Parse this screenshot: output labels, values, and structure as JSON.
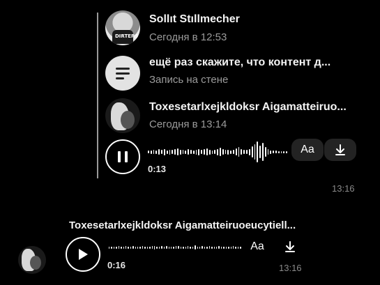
{
  "forwarded": {
    "items": [
      {
        "name": "Sollıt Stıllmecher",
        "time": "Сегодня в 12:53",
        "avatar_text": "DIRTERS"
      },
      {
        "title": "ещё раз скажите, что контент д...",
        "subtitle": "Запись на стене"
      },
      {
        "name": "Toxesetarlxejkldoksr Aigamatteiruo...",
        "time": "Сегодня в 13:14"
      }
    ],
    "voice": {
      "duration": "0:13",
      "state": "playing",
      "transcribe_label": "Aa"
    },
    "timestamp": "13:16"
  },
  "message": {
    "sender": "Toxesetarlxejkldoksr Aigamatteiruoeucytiell...",
    "voice": {
      "duration": "0:16",
      "state": "paused",
      "transcribe_label": "Aa"
    },
    "timestamp": "13:16"
  },
  "colors": {
    "background": "#000000",
    "secondary_text": "#9b9b9b",
    "button_bg": "#232323"
  }
}
